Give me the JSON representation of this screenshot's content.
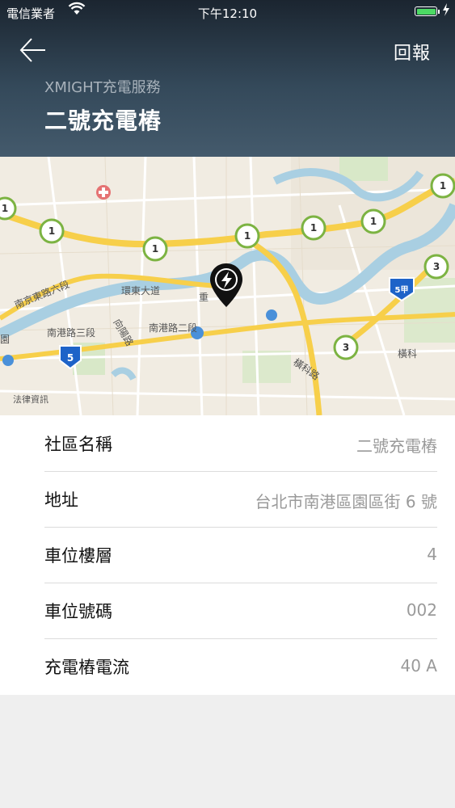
{
  "status_bar": {
    "carrier": "電信業者",
    "time": "下午12:10"
  },
  "header": {
    "back_icon": "arrow-left-icon",
    "report_label": "回報",
    "service_name": "XMIGHT充電服務",
    "title": "二號充電樁"
  },
  "map": {
    "labels": {
      "road1": "南京東路六段",
      "road2": "環東大道",
      "road3": "南港路三段",
      "road4": "向陽路",
      "road5": "南港路二段",
      "road6": "橫科路",
      "area1": "橫科",
      "poi1": "法律資訊",
      "edge1": "園",
      "road7": "重"
    },
    "markers": [
      "1",
      "1",
      "1",
      "1",
      "1",
      "1",
      "1",
      "3",
      "3",
      "5",
      "5甲"
    ],
    "pin_icon": "charging-pin-icon"
  },
  "details": [
    {
      "label": "社區名稱",
      "value": "二號充電樁"
    },
    {
      "label": "地址",
      "value": "台北市南港區園區街 6 號"
    },
    {
      "label": "車位樓層",
      "value": "4"
    },
    {
      "label": "車位號碼",
      "value": "002"
    },
    {
      "label": "充電樁電流",
      "value": "40 A"
    }
  ],
  "colors": {
    "header_top": "#1b2530",
    "header_bottom": "#445a6c",
    "battery": "#4cd964",
    "highway": "#f7cf4a",
    "river": "#a9cfe2",
    "marker_green": "#7cb342"
  }
}
